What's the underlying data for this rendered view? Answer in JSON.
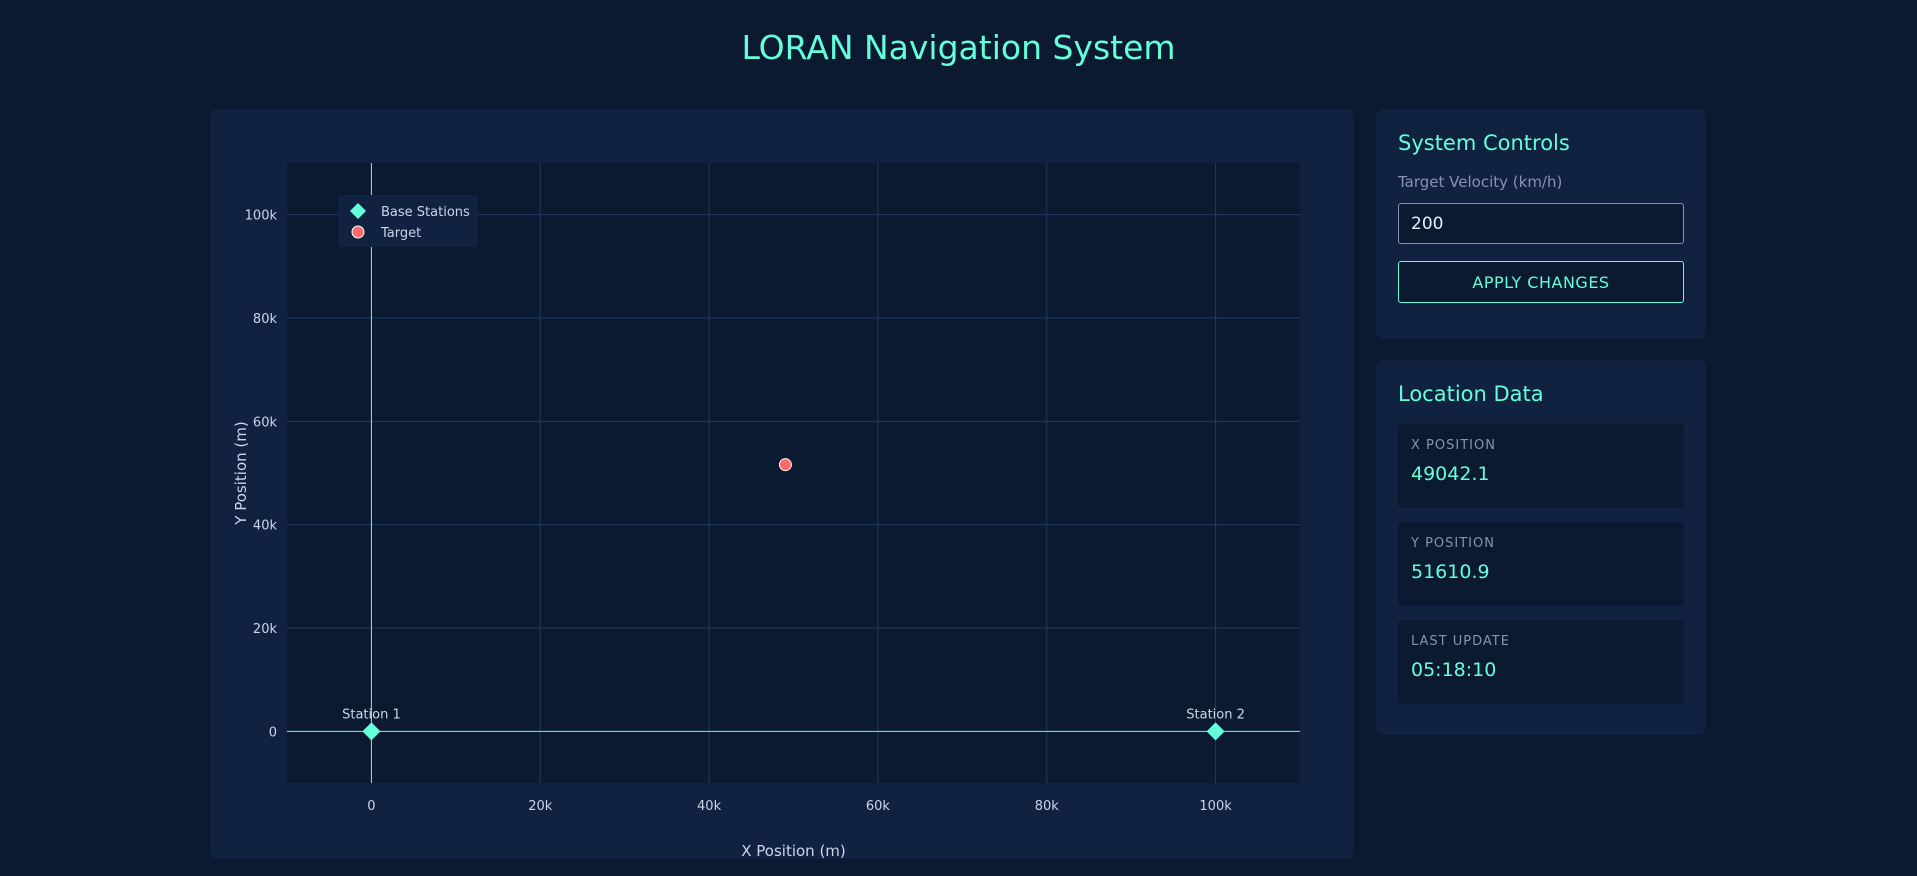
{
  "page": {
    "title": "LORAN Navigation System"
  },
  "controls": {
    "title": "System Controls",
    "velocity_label": "Target Velocity (km/h)",
    "velocity_value": "200",
    "apply_label": "APPLY CHANGES"
  },
  "location": {
    "title": "Location Data",
    "x_label": "X POSITION",
    "x_value": "49042.1",
    "y_label": "Y POSITION",
    "y_value": "51610.9",
    "update_label": "LAST UPDATE",
    "update_value": "05:18:10"
  },
  "colors": {
    "accent": "#64ffda",
    "target": "#ff6b6b",
    "background": "#0b1a30",
    "panel": "#112240"
  },
  "chart_data": {
    "type": "scatter",
    "xlabel": "X Position (m)",
    "ylabel": "Y Position (m)",
    "xlim": [
      -10000,
      110000
    ],
    "ylim": [
      -10000,
      110000
    ],
    "x_ticks": [
      0,
      20000,
      40000,
      60000,
      80000,
      100000
    ],
    "x_tick_labels": [
      "0",
      "20k",
      "40k",
      "60k",
      "80k",
      "100k"
    ],
    "y_ticks": [
      0,
      20000,
      40000,
      60000,
      80000,
      100000
    ],
    "y_tick_labels": [
      "0",
      "20k",
      "40k",
      "60k",
      "80k",
      "100k"
    ],
    "grid": true,
    "legend_position": "top-left",
    "series": [
      {
        "name": "Base Stations",
        "marker": "diamond",
        "color": "#64ffda",
        "points": [
          {
            "x": 0,
            "y": 0,
            "label": "Station 1"
          },
          {
            "x": 100000,
            "y": 0,
            "label": "Station 2"
          }
        ]
      },
      {
        "name": "Target",
        "marker": "circle",
        "color": "#ff6b6b",
        "points": [
          {
            "x": 49042.1,
            "y": 51610.9
          }
        ]
      }
    ]
  }
}
